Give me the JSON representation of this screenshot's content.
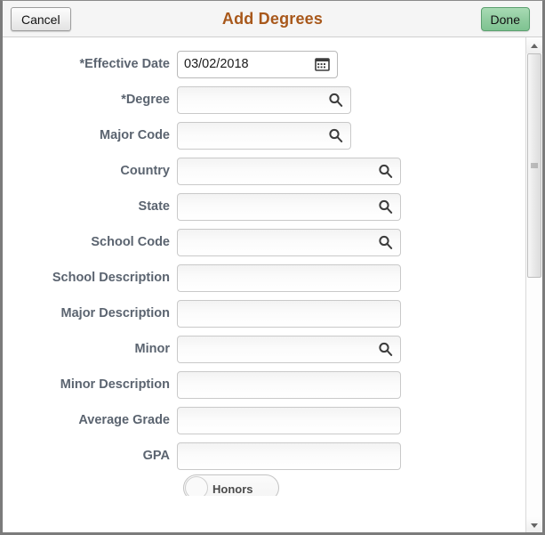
{
  "header": {
    "title": "Add Degrees",
    "cancel_label": "Cancel",
    "done_label": "Done"
  },
  "form": {
    "rows": [
      {
        "label": "*Effective Date",
        "value": "03/02/2018",
        "icon": "calendar-icon",
        "width": "date",
        "filled": true,
        "name": "effective-date"
      },
      {
        "label": "*Degree",
        "value": "",
        "icon": "search-icon",
        "width": "narrow",
        "filled": false,
        "name": "degree"
      },
      {
        "label": "Major Code",
        "value": "",
        "icon": "search-icon",
        "width": "narrow",
        "filled": false,
        "name": "major-code"
      },
      {
        "label": "Country",
        "value": "",
        "icon": "search-icon",
        "width": "wide",
        "filled": false,
        "name": "country"
      },
      {
        "label": "State",
        "value": "",
        "icon": "search-icon",
        "width": "wide",
        "filled": false,
        "name": "state"
      },
      {
        "label": "School Code",
        "value": "",
        "icon": "search-icon",
        "width": "wide",
        "filled": false,
        "name": "school-code"
      },
      {
        "label": "School Description",
        "value": "",
        "icon": "",
        "width": "wide",
        "filled": false,
        "name": "school-description"
      },
      {
        "label": "Major Description",
        "value": "",
        "icon": "",
        "width": "wide",
        "filled": false,
        "name": "major-description"
      },
      {
        "label": "Minor",
        "value": "",
        "icon": "search-icon",
        "width": "wide",
        "filled": false,
        "name": "minor"
      },
      {
        "label": "Minor Description",
        "value": "",
        "icon": "",
        "width": "wide",
        "filled": false,
        "name": "minor-description"
      },
      {
        "label": "Average Grade",
        "value": "",
        "icon": "",
        "width": "wide",
        "filled": false,
        "name": "average-grade"
      },
      {
        "label": "GPA",
        "value": "",
        "icon": "",
        "width": "wide",
        "filled": false,
        "name": "gpa"
      }
    ],
    "toggle": {
      "label": "Honors"
    }
  },
  "scrollbar": {
    "up_icon": "scroll-up-arrow-icon",
    "down_icon": "scroll-down-arrow-icon"
  },
  "colors": {
    "title": "#a8581b",
    "label": "#5b6470",
    "done_button": "#8fcc9f",
    "header_bg": "#f5f5f5"
  }
}
